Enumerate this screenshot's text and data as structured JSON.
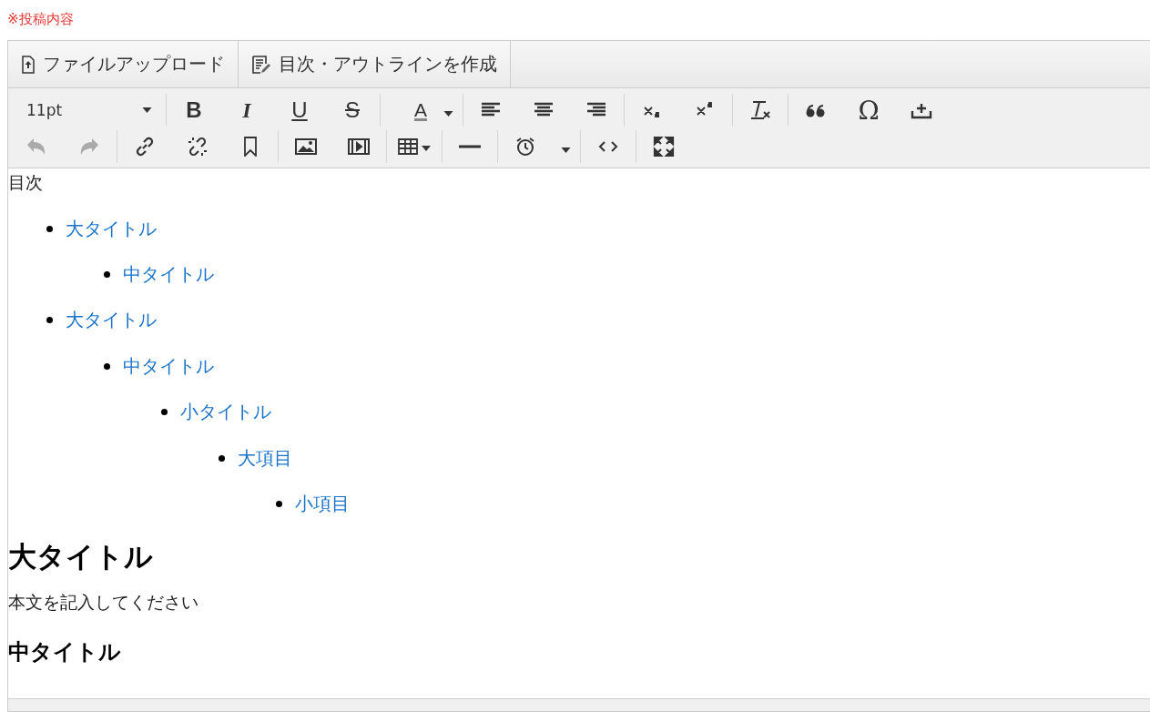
{
  "section_label": "※投稿内容",
  "menu": [
    {
      "label": "ファイルアップロード"
    },
    {
      "label": "目次・アウトラインを作成"
    }
  ],
  "toolbar": {
    "font_size": "11pt",
    "bold": "B",
    "italic": "I",
    "underline": "U",
    "strike": "S",
    "text_color": "A",
    "special_char": "Ω",
    "undo": {
      "disabled": true
    },
    "redo": {
      "disabled": true
    }
  },
  "toc_title": "目次",
  "toc": [
    {
      "label": "大タイトル",
      "children": [
        {
          "label": "中タイトル"
        }
      ]
    },
    {
      "label": "大タイトル",
      "children": [
        {
          "label": "中タイトル",
          "children": [
            {
              "label": "小タイトル",
              "children": [
                {
                  "label": "大項目",
                  "children": [
                    {
                      "label": "小項目"
                    }
                  ]
                }
              ]
            }
          ]
        }
      ]
    }
  ],
  "body": [
    {
      "kind": "h1",
      "text": "大タイトル"
    },
    {
      "kind": "p",
      "text": "本文を記入してください"
    },
    {
      "kind": "h2",
      "text": "中タイトル"
    }
  ]
}
